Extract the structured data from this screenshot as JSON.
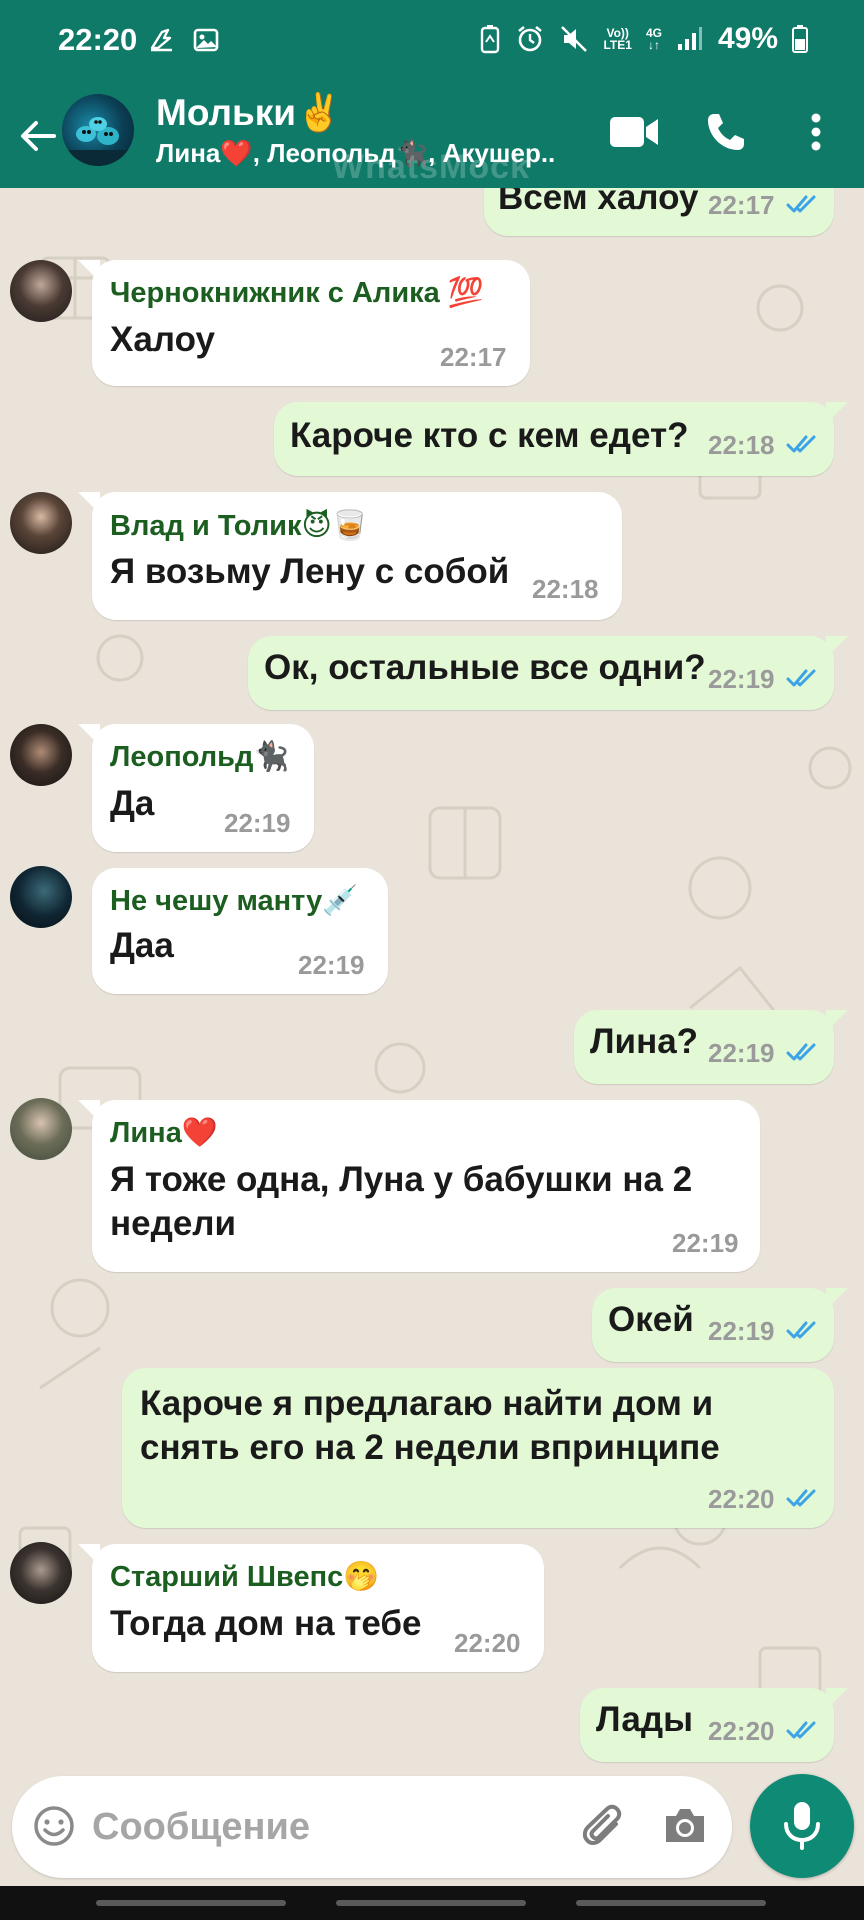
{
  "status_bar": {
    "time": "22:20",
    "battery": "49%",
    "volte": "Vo))",
    "lte": "LTE1",
    "network": "4G"
  },
  "header": {
    "title": "Мольки✌️",
    "subtitle": "Лина❤️, Леопольд🐈‍⬛, Акушер..",
    "watermark": "WhatsMock",
    "avatar_label": "Молькu"
  },
  "messages": [
    {
      "dir": "out",
      "text": "Всем халоу",
      "time": "22:17",
      "ticks": true
    },
    {
      "dir": "in",
      "sender": "Чернокнижник с Алика 💯",
      "text": "Халоу",
      "time": "22:17"
    },
    {
      "dir": "out",
      "text": "Кароче кто с кем едет?",
      "time": "22:18",
      "ticks": true
    },
    {
      "dir": "in",
      "sender": "Влад и Толик😈🥃",
      "text": "Я возьму Лену с собой",
      "time": "22:18"
    },
    {
      "dir": "out",
      "text": "Ок, остальные все одни?",
      "time": "22:19",
      "ticks": true
    },
    {
      "dir": "in",
      "sender": "Леопольд🐈‍⬛",
      "text": "Да",
      "time": "22:19"
    },
    {
      "dir": "in",
      "sender": "Не чешу манту💉",
      "text": "Даа",
      "time": "22:19"
    },
    {
      "dir": "out",
      "text": "Лина?",
      "time": "22:19",
      "ticks": true
    },
    {
      "dir": "in",
      "sender": "Лина❤️",
      "text_lines": [
        "Я тоже одна, Луна у бабушки на 2",
        "недели"
      ],
      "time": "22:19"
    },
    {
      "dir": "out",
      "text": "Окей",
      "time": "22:19",
      "ticks": true
    },
    {
      "dir": "out",
      "text_lines": [
        "Кароче я предлагаю найти дом и",
        "снять его на 2 недели впринципе"
      ],
      "time": "22:20",
      "ticks": true
    },
    {
      "dir": "in",
      "sender": "Старший Швепс🤭",
      "text": "Тогда дом на тебе",
      "time": "22:20"
    },
    {
      "dir": "out",
      "text": "Лады",
      "time": "22:20",
      "ticks": true
    }
  ],
  "composer": {
    "placeholder": "Сообщение"
  },
  "colors": {
    "header": "#0f7a68",
    "outgoing_bubble": "#e3f9d6",
    "incoming_bubble": "#ffffff",
    "sender_name": "#1b5e20",
    "ticks": "#3ba3e6",
    "mic_button": "#0f8a75"
  },
  "icons": {
    "back": "arrow-left-icon",
    "video": "video-camera-icon",
    "call": "phone-icon",
    "more": "more-vertical-icon",
    "emoji": "smiley-icon",
    "attach": "paperclip-icon",
    "camera": "camera-icon",
    "mic": "microphone-icon"
  }
}
